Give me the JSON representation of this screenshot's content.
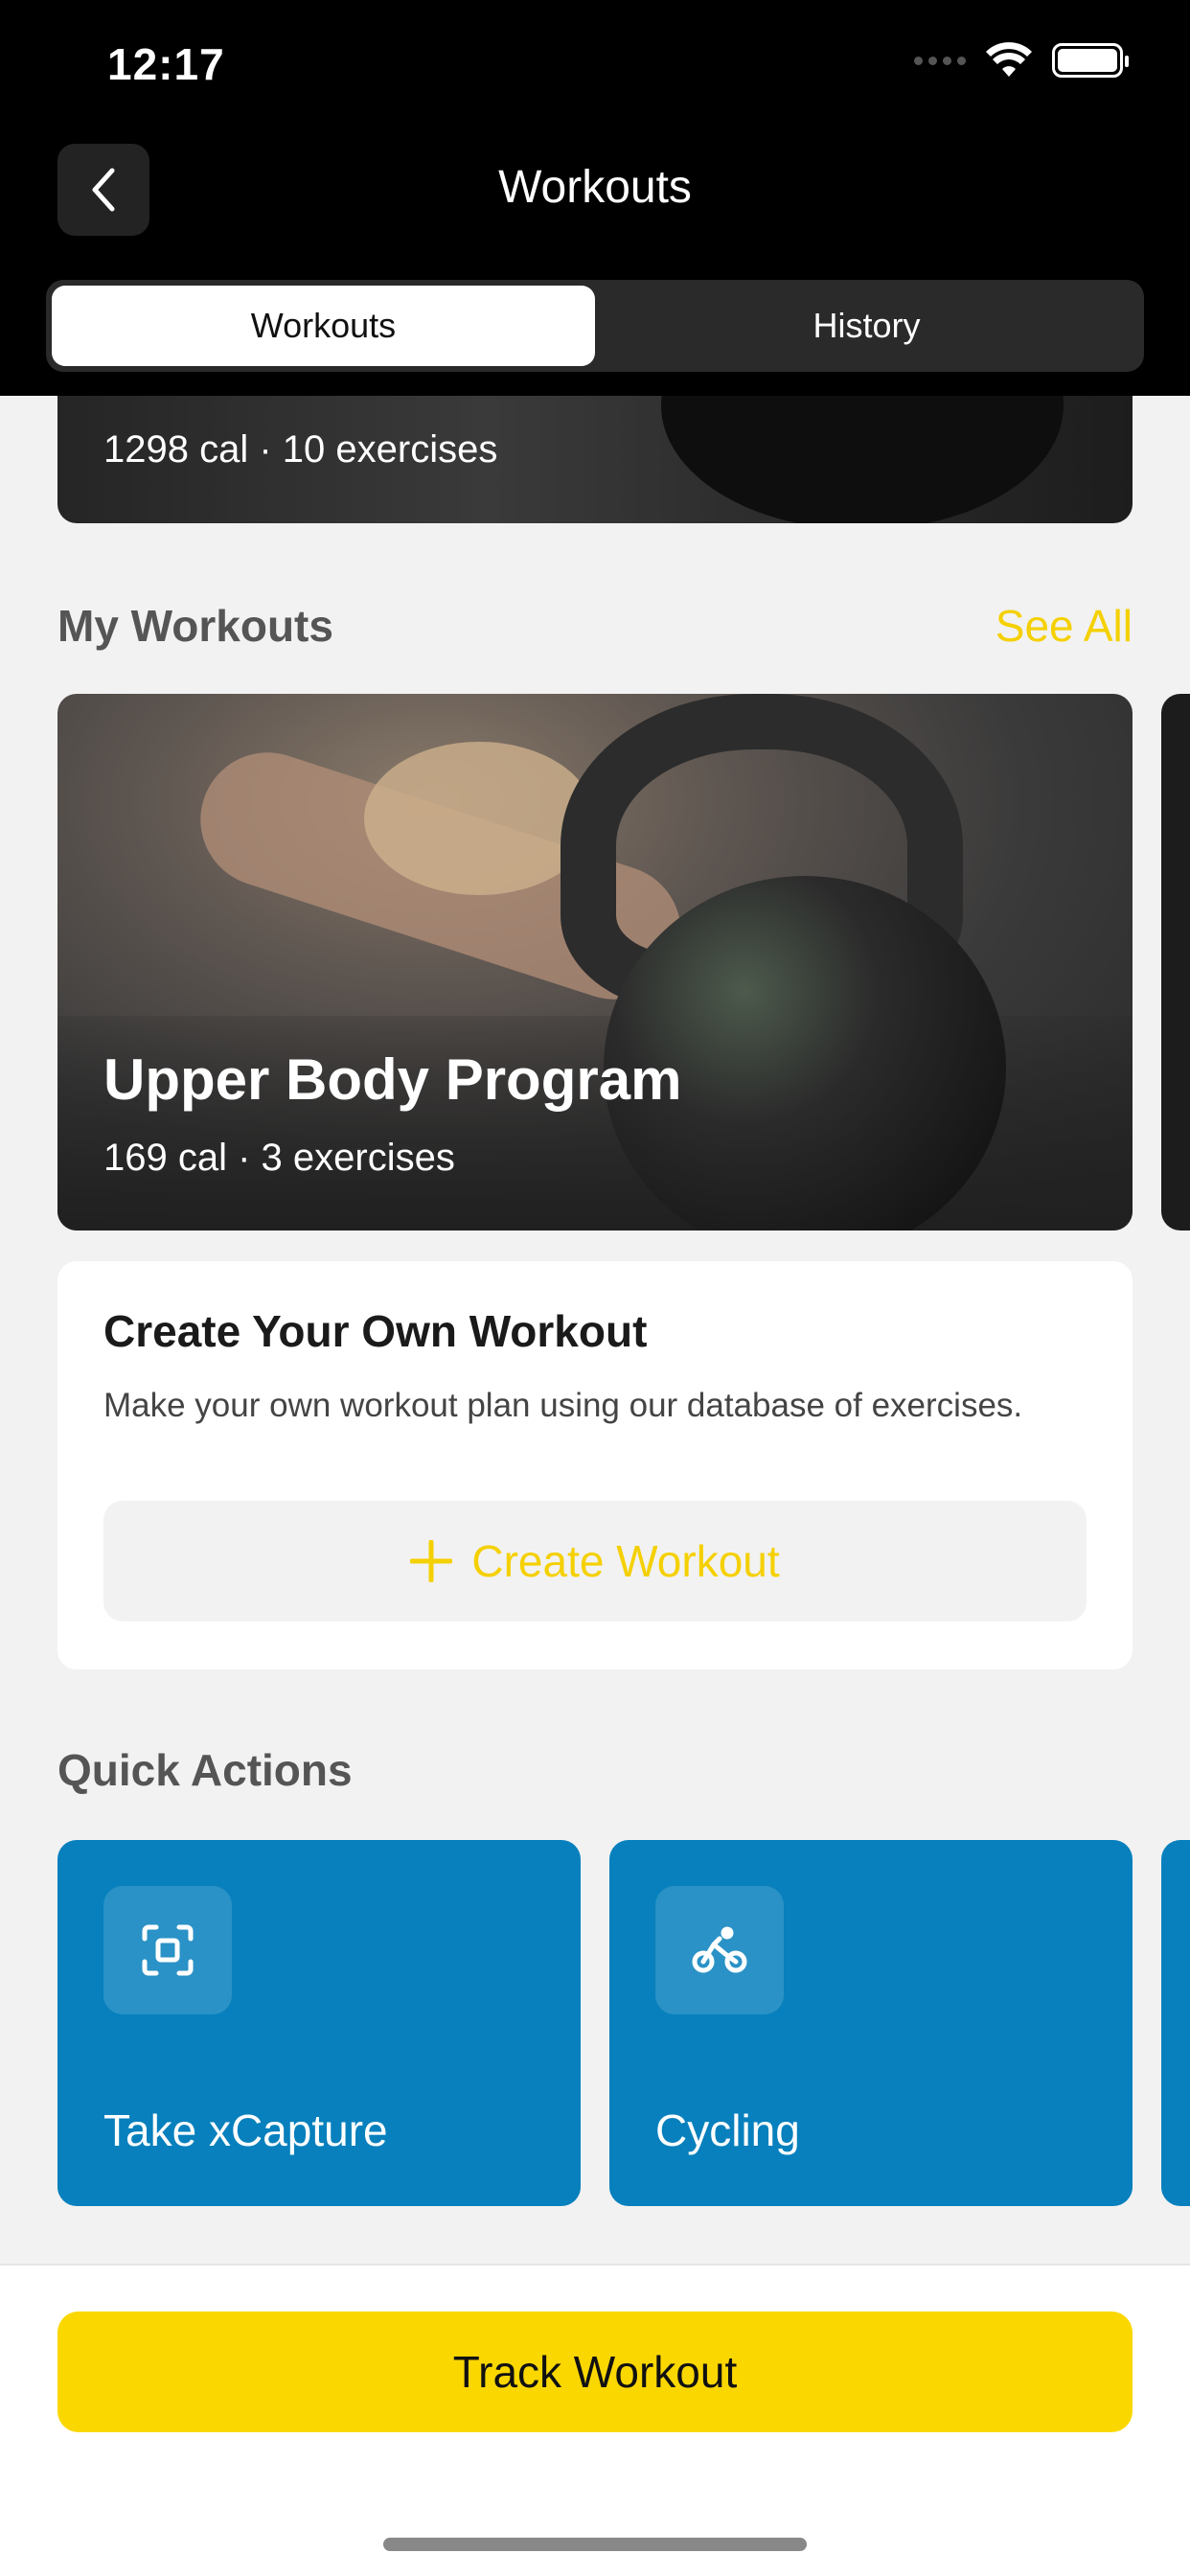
{
  "status_bar": {
    "time": "12:17"
  },
  "nav": {
    "title": "Workouts"
  },
  "tabs": [
    {
      "label": "Workouts",
      "active": true
    },
    {
      "label": "History",
      "active": false
    }
  ],
  "top_card": {
    "meta": "1298 cal · 10 exercises"
  },
  "my_workouts": {
    "title": "My Workouts",
    "see_all": "See All",
    "program": {
      "title": "Upper Body Program",
      "meta": "169 cal · 3 exercises"
    }
  },
  "create_card": {
    "title": "Create Your Own Workout",
    "description": "Make your own workout plan using our database of exercises.",
    "button_label": "Create Workout"
  },
  "quick_actions": {
    "title": "Quick Actions",
    "items": [
      {
        "label": "Take xCapture",
        "icon": "scan-icon"
      },
      {
        "label": "Cycling",
        "icon": "bicycle-icon"
      }
    ]
  },
  "footer": {
    "track_label": "Track Workout"
  },
  "colors": {
    "accent": "#F5D000",
    "button": "#FBD700",
    "action_card": "#0780BD",
    "header": "#000000"
  }
}
